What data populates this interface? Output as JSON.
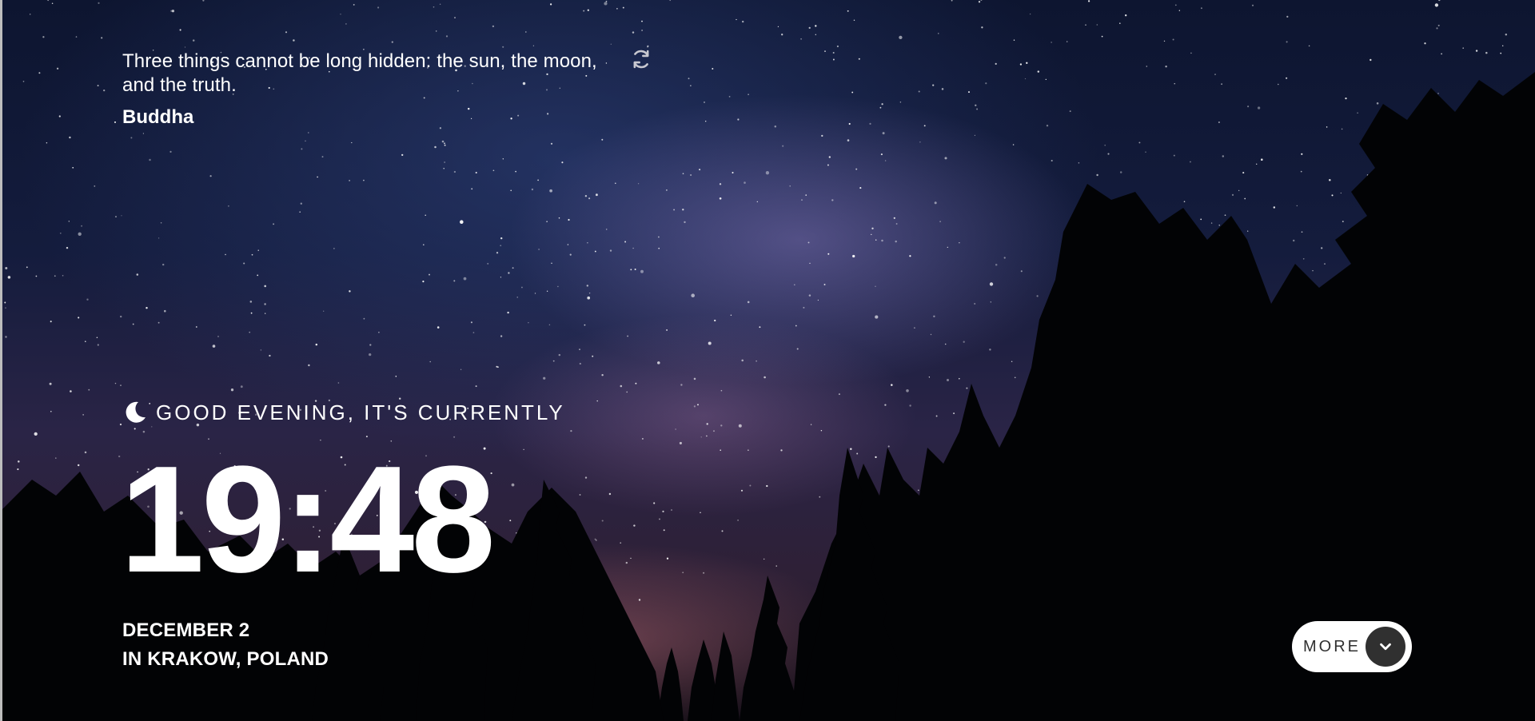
{
  "quote": {
    "text": "Three things cannot be long hidden: the sun, the moon, and the truth.",
    "author": "Buddha",
    "refresh_icon": "refresh-icon"
  },
  "greeting": {
    "icon": "moon-icon",
    "text": "GOOD EVENING, IT'S CURRENTLY"
  },
  "clock": {
    "time": "19:48"
  },
  "date": {
    "text": "DECEMBER 2",
    "location": "IN KRAKOW, POLAND"
  },
  "more_button": {
    "label": "MORE",
    "icon": "chevron-down-icon"
  },
  "colors": {
    "text": "#ffffff",
    "button_bg": "#ffffff",
    "button_text": "#303030",
    "button_icon_bg": "#303030"
  }
}
